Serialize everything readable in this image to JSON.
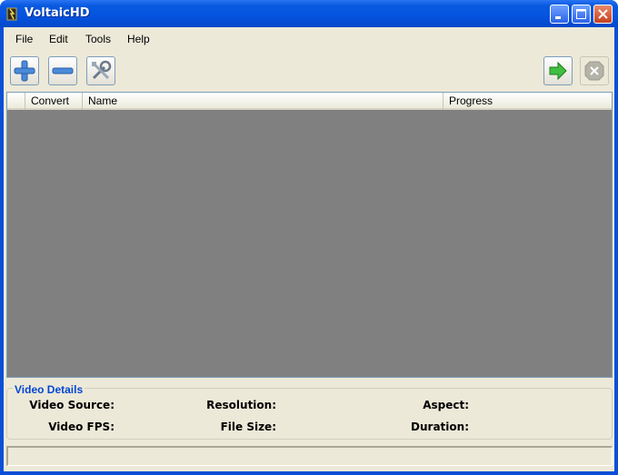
{
  "window": {
    "title": "VoltaicHD"
  },
  "menu": {
    "items": [
      "File",
      "Edit",
      "Tools",
      "Help"
    ]
  },
  "toolbar": {
    "buttons": [
      "add-icon",
      "remove-icon",
      "tools-icon",
      "convert-arrow-icon",
      "stop-icon"
    ]
  },
  "list": {
    "columns": [
      "Convert",
      "Name",
      "Progress"
    ],
    "rows": []
  },
  "details": {
    "title": "Video Details",
    "video_source": "Video Source:",
    "resolution": "Resolution:",
    "aspect": "Aspect:",
    "video_fps": "Video FPS:",
    "file_size": "File Size:",
    "duration": "Duration:"
  },
  "status": {
    "text": ""
  },
  "colors": {
    "titlebar": "#0553df",
    "client": "#ece9d8",
    "list_background": "#808080",
    "group_title": "#0046d5"
  }
}
